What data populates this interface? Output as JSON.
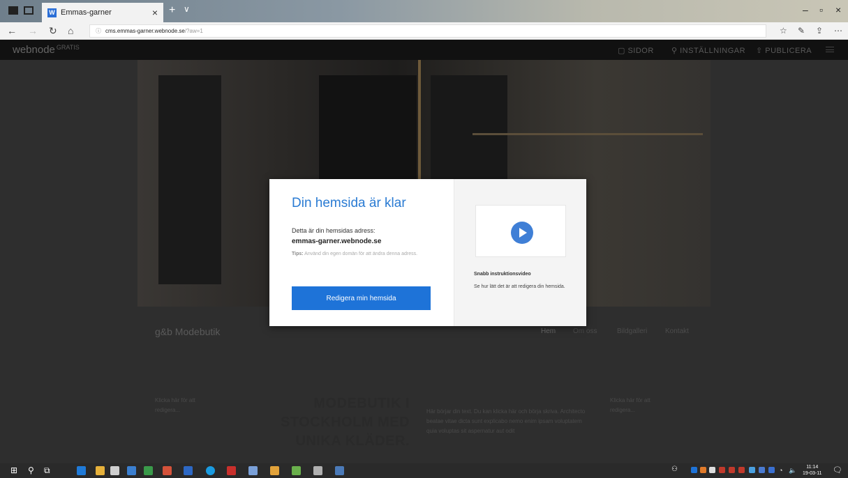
{
  "browser": {
    "tab_title": "Emmas-garner",
    "tab_favicon_letter": "W",
    "new_tab_glyph": "+",
    "tab_dropdown_glyph": "∨",
    "url_host": "cms.emmas-garner.webnode.se",
    "url_query": "/?aw=1",
    "icons": [
      "tab-manager-icon",
      "tab-back-icon",
      "back-icon",
      "forward-icon",
      "refresh-icon",
      "home-icon",
      "info-icon",
      "favorites-icon",
      "reading-list-icon",
      "share-icon",
      "more-icon"
    ]
  },
  "webnode_bar": {
    "logo": "webnode",
    "logo_badge": "GRATIS",
    "pages_label": "SIDOR",
    "settings_label": "INSTÄLLNINGAR",
    "publish_label": "PUBLICERA"
  },
  "site": {
    "title": "g&b Modebutik",
    "nav": [
      "Hem",
      "Om oss",
      "Bildgalleri",
      "Kontakt"
    ],
    "left_placeholder": "Klicka här för att redigera...",
    "right_placeholder": "Klicka här för att redigera...",
    "headline": "MODEBUTIK I STOCKHOLM MED UNIKA KLÄDER.",
    "body_text": "Här börjar din text. Du kan klicka här och börja skriva. Architecto beatae vitae dicta sunt explicabo nemo enim ipsam voluptatem quia voluptas sit aspernatur aut odit"
  },
  "modal": {
    "title": "Din hemsida är klar",
    "address_label": "Detta är din hemsidas adress:",
    "address": "emmas-garner.webnode.se",
    "tip_label": "Tips:",
    "tip_text": "Använd din egen domän för att ändra denna adress.",
    "cta_label": "Redigera min hemsida",
    "video_title": "Snabb instruktionsvideo",
    "video_desc": "Se hur lätt det är att redigera din hemsida."
  },
  "taskbar": {
    "time": "11:14",
    "date": "19-03-11"
  },
  "colors": {
    "accent": "#2a7bd3",
    "button": "#1e73d8",
    "play": "#3f7fd6"
  }
}
